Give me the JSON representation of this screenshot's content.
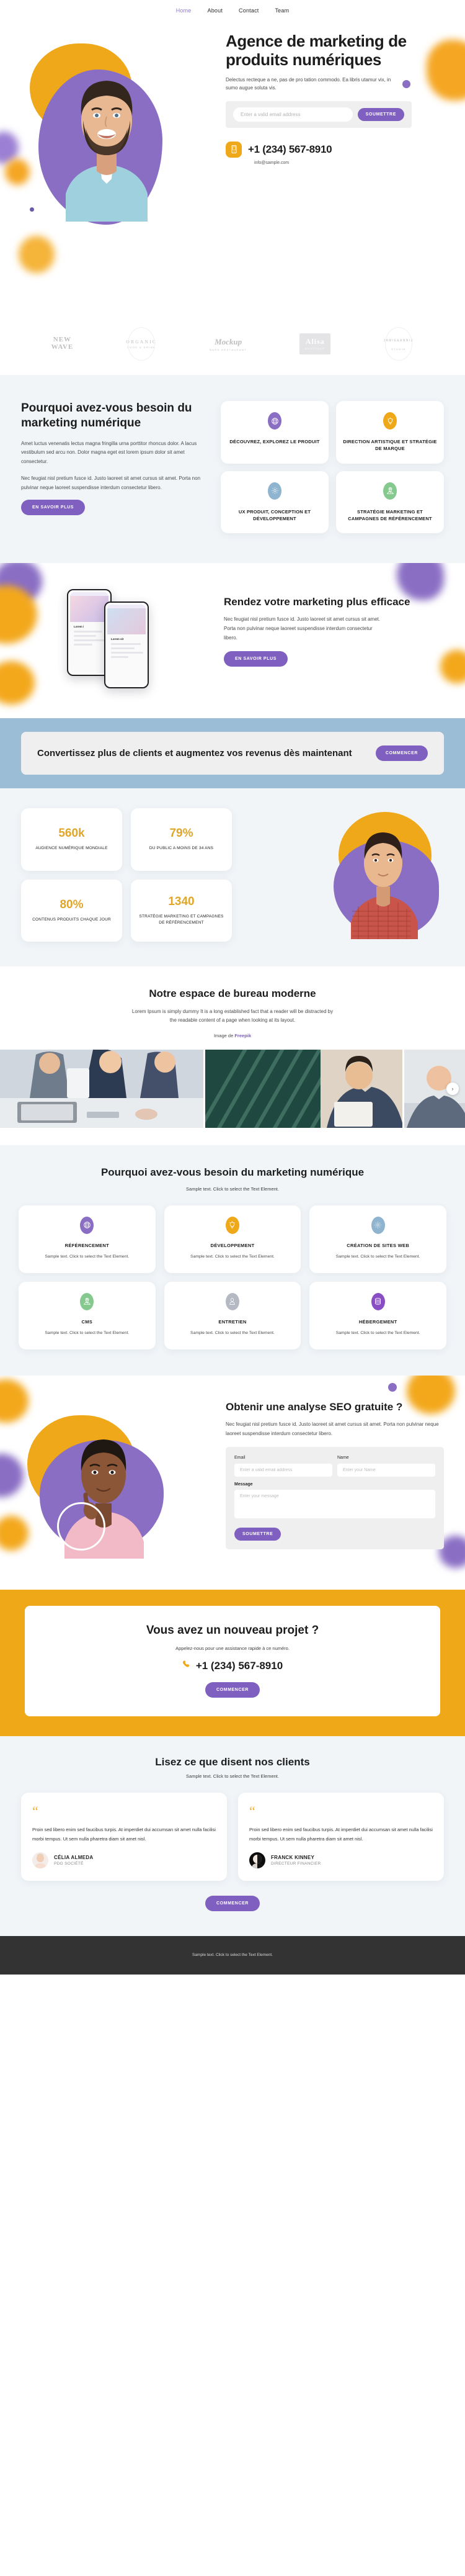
{
  "nav": {
    "items": [
      {
        "label": "Home",
        "active": true
      },
      {
        "label": "About",
        "active": false
      },
      {
        "label": "Contact",
        "active": false
      },
      {
        "label": "Team",
        "active": false
      }
    ]
  },
  "hero": {
    "title": "Agence de marketing de produits numériques",
    "subtitle": "Delectus recteque a ne, pas de pro tation commodo. Ea libris utamur vix, in sumo augue soluta vis.",
    "email_placeholder": "Enter a valid email address",
    "submit_label": "SOUMETTRE",
    "phone": "+1 (234) 567-8910",
    "email": "info@sample.com"
  },
  "logos": [
    {
      "line1": "NEW",
      "line2": "WAVE",
      "line3": ""
    },
    {
      "line1": "ORGANIC",
      "line2": "",
      "line3": "FOOD & DRINK"
    },
    {
      "line1": "Mockup",
      "line2": "",
      "line3": "BARS RESTAURANT"
    },
    {
      "line1": "Alisa",
      "line2": "",
      "line3": "BOUTIQUE"
    },
    {
      "line1": "JAMIE&ANNIE",
      "line2": "",
      "line3": "STUDIO"
    }
  ],
  "why": {
    "title": "Pourquoi avez-vous besoin du marketing numérique",
    "paragraph1": "Amet luctus venenatis lectus magna fringilla urna porttitor rhoncus dolor. A lacus vestibulum sed arcu non. Dolor magna eget est lorem ipsum dolor sit amet consectetur.",
    "paragraph2": "Nec feugiat nisl pretium fusce id. Justo laoreet sit amet cursus sit amet. Porta non pulvinar neque laoreet suspendisse interdum consectetur libero.",
    "button_label": "EN SAVOIR PLUS",
    "cards": [
      {
        "title": "DÉCOUVREZ, EXPLOREZ LE PRODUIT",
        "icon": "globe-icon",
        "color": "#8a6ec4"
      },
      {
        "title": "DIRECTION ARTISTIQUE ET STRATÉGIE DE MARQUE",
        "icon": "lightbulb-icon",
        "color": "#f0a81b"
      },
      {
        "title": "UX PRODUIT, CONCEPTION ET DÉVELOPPEMENT",
        "icon": "gear-icon",
        "color": "#8fb4cf"
      },
      {
        "title": "STRATÉGIE MARKETING ET CAMPAGNES DE RÉFÉRENCEMENT",
        "icon": "map-pin-icon",
        "color": "#85c98f"
      }
    ]
  },
  "phones": {
    "title": "Rendez votre marketing plus efficace",
    "paragraph": "Nec feugiat nisl pretium fusce id. Justo laoreet sit amet cursus sit amet. Porta non pulvinar neque laoreet suspendisse interdum consectetur libero.",
    "button_label": "EN SAVOIR PLUS",
    "mock_title_1": "Lorem i",
    "mock_title_2": "Lorem sit"
  },
  "cta_blue": {
    "title": "Convertissez plus de clients et augmentez vos revenus dès maintenant",
    "button_label": "COMMENCER"
  },
  "stats": {
    "items": [
      {
        "value": "560k",
        "label": "AUDIENCE NUMÉRIQUE MONDIALE"
      },
      {
        "value": "79%",
        "label": "DU PUBLIC A MOINS DE 34 ANS"
      },
      {
        "value": "80%",
        "label": "CONTENUS PRODUITS CHAQUE JOUR"
      },
      {
        "value": "1340",
        "label": "STRATÉGIE MARKETING ET CAMPAGNES DE RÉFÉRENCEMENT"
      }
    ]
  },
  "office": {
    "title": "Notre espace de bureau moderne",
    "paragraph": "Lorem Ipsum is simply dummy It is a long established fact that a reader will be distracted by the readable content of a page when looking at its layout.",
    "credit_prefix": "Image de ",
    "credit_link": "Freepik",
    "next_arrow": "›"
  },
  "services": {
    "title": "Pourquoi avez-vous besoin du marketing numérique",
    "subtitle": "Sample text. Click to select the Text Element.",
    "cards": [
      {
        "title": "RÉFÉRENCEMENT",
        "text": "Sample text. Click to select the Text Element.",
        "icon": "globe-icon",
        "color": "#8a6ec4"
      },
      {
        "title": "DÉVELOPPEMENT",
        "text": "Sample text. Click to select the Text Element.",
        "icon": "lightbulb-icon",
        "color": "#f0a81b"
      },
      {
        "title": "CRÉATION DE SITES WEB",
        "text": "Sample text. Click to select the Text Element.",
        "icon": "gear-icon",
        "color": "#8fb4cf"
      },
      {
        "title": "CMS",
        "text": "Sample text. Click to select the Text Element.",
        "icon": "map-pin-icon",
        "color": "#85c98f"
      },
      {
        "title": "ENTRETIEN",
        "text": "Sample text. Click to select the Text Element.",
        "icon": "user-icon",
        "color": "#b5b9c4"
      },
      {
        "title": "HÉBERGEMENT",
        "text": "Sample text. Click to select the Text Element.",
        "icon": "database-icon",
        "color": "#8a4ec4"
      }
    ]
  },
  "seo": {
    "title": "Obtenir une analyse SEO gratuite ?",
    "paragraph": "Nec feugiat nisl pretium fusce id. Justo laoreet sit amet cursus sit amet. Porta non pulvinar neque laoreet suspendisse interdum consectetur libero.",
    "email_label": "Email",
    "email_placeholder": "Enter a valid email address",
    "name_label": "Name",
    "name_placeholder": "Enter your Name",
    "message_label": "Message",
    "message_placeholder": "Enter your message",
    "submit_label": "SOUMETTRE"
  },
  "cta_yellow": {
    "title": "Vous avez un nouveau projet ?",
    "paragraph": "Appelez-nous pour une assistance rapide à ce numéro.",
    "phone": "+1 (234) 567-8910",
    "button_label": "COMMENCER"
  },
  "testimonials": {
    "title": "Lisez ce que disent nos clients",
    "subtitle": "Sample text. Click to select the Text Element.",
    "quote_mark": "“",
    "items": [
      {
        "text": "Proin sed libero enim sed faucibus turpis. At imperdiet dui accumsan sit amet nulla facilisi morbi tempus. Ut sem nulla pharetra diam sit amet nisl.",
        "name": "CÉLIA ALMEDA",
        "role": "PDG SOCIÉTÉ"
      },
      {
        "text": "Proin sed libero enim sed faucibus turpis. At imperdiet dui accumsan sit amet nulla facilisi morbi tempus. Ut sem nulla pharetra diam sit amet nisl.",
        "name": "FRANCK KINNEY",
        "role": "DIRECTEUR FINANCIER"
      }
    ],
    "button_label": "COMMENCER"
  },
  "footer": {
    "text": "Sample text. Click to select the Text Element."
  },
  "colors": {
    "purple": "#7f5fc0",
    "orange": "#f0a81b",
    "blue": "#9bbdd6",
    "light_bg": "#f1f5f8",
    "yellow": "#efa817"
  }
}
